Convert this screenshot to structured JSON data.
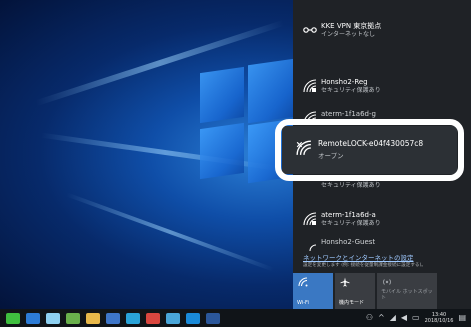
{
  "flyout": {
    "networks": [
      {
        "name": "KKE VPN 東京拠点",
        "status": "インターネットなし",
        "icon": "vpn-icon"
      },
      {
        "name": "Honsho2-Reg",
        "status": "セキュリティ保護あり",
        "icon": "wifi-secured-icon"
      },
      {
        "name": "aterm-1f1a6d-g",
        "status": "セキュリティ保護あり",
        "icon": "wifi-secured-icon"
      },
      {
        "name": "RemoteLOCK-e04f430057c8",
        "status": "オープン",
        "icon": "wifi-open-icon"
      },
      {
        "name": "",
        "status": "セキュリティ保護あり",
        "icon": "wifi-secured-icon"
      },
      {
        "name": "aterm-1f1a6d-a",
        "status": "セキュリティ保護あり",
        "icon": "wifi-secured-icon"
      },
      {
        "name": "Honsho2-Guest",
        "status": "",
        "icon": "wifi-secured-icon"
      }
    ],
    "settings_link": "ネットワークとインターネットの設定",
    "settings_description": "設定を変更します (例: 接続を従量制課金接続に設定する)。",
    "quick_actions": [
      {
        "label": "Wi-Fi",
        "icon": "wifi-icon",
        "active": true
      },
      {
        "label": "機内モード",
        "icon": "airplane-icon",
        "active": false
      },
      {
        "label": "モバイル ホットスポット",
        "icon": "hotspot-icon",
        "active": false
      }
    ]
  },
  "taskbar": {
    "clock_time": "13:40",
    "clock_date": "2018/10/16"
  },
  "colors": {
    "flyout_bg": "#1f2226",
    "wifi_tile_active": "#3a78c3",
    "tile_inactive": "#3a3d42",
    "highlight_border": "#ffffff"
  }
}
